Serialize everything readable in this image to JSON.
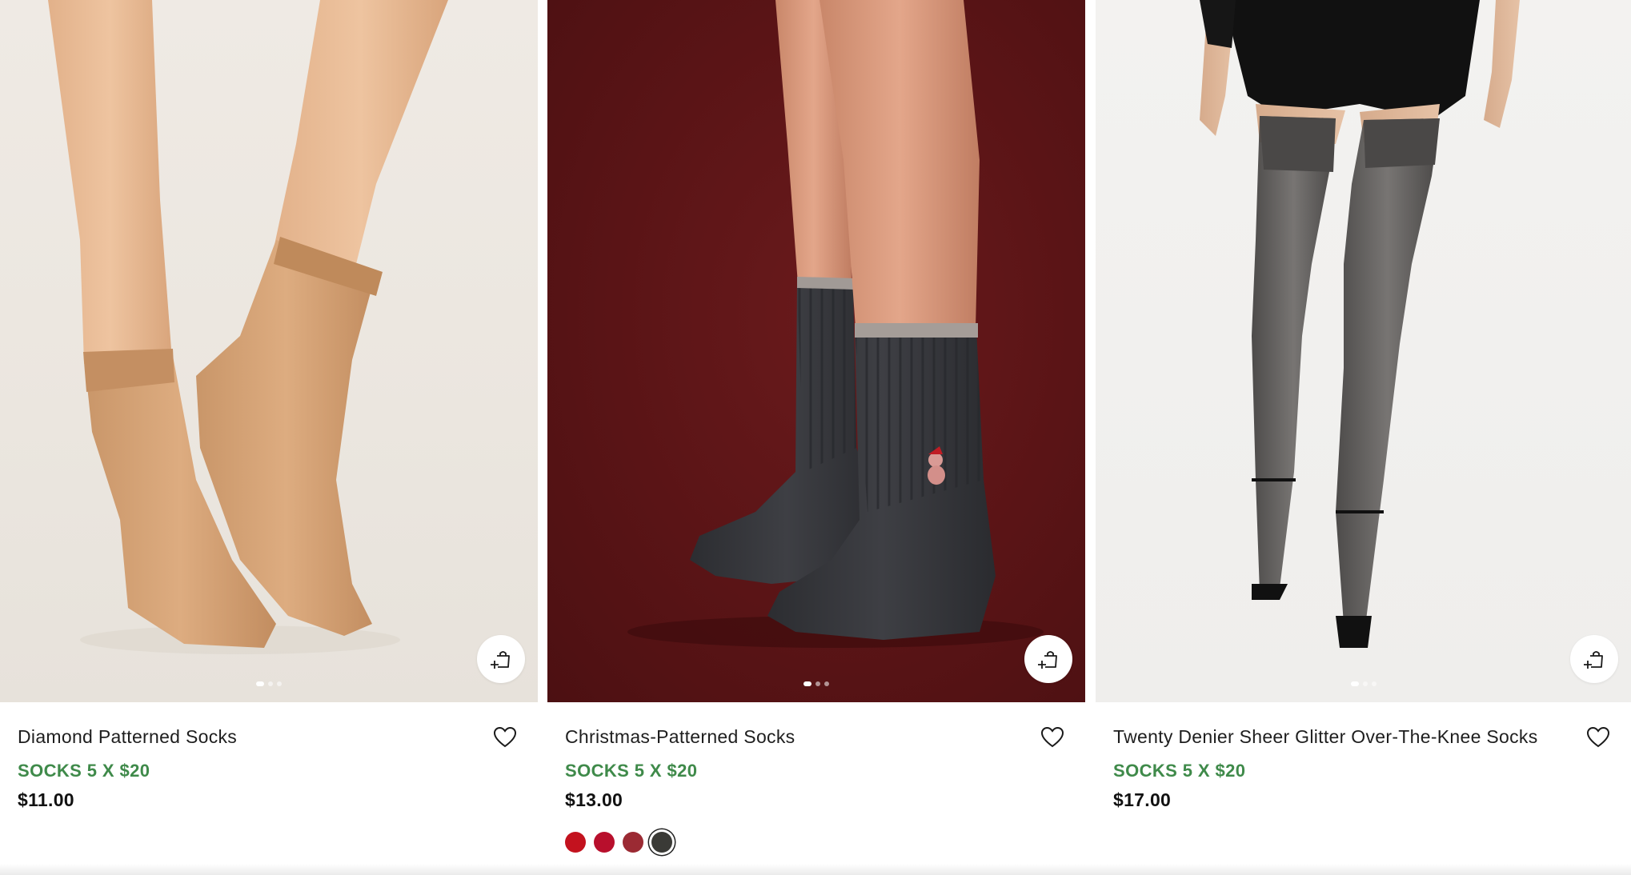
{
  "products": [
    {
      "name": "Diamond Patterned Socks",
      "promo": "SOCKS 5 X $20",
      "price": "$11.00",
      "image_dots": 3,
      "active_dot": 1
    },
    {
      "name": "Christmas-Patterned Socks",
      "promo": "SOCKS 5 X $20",
      "price": "$13.00",
      "image_dots": 3,
      "active_dot": 1,
      "swatches": [
        "#c3121e",
        "#b80f2c",
        "#9b2a33",
        "#3a3a36"
      ],
      "selected_swatch": 4
    },
    {
      "name": "Twenty Denier Sheer Glitter Over-The-Knee Socks",
      "promo": "SOCKS 5 X $20",
      "price": "$17.00",
      "image_dots": 3,
      "active_dot": 1
    }
  ],
  "icons": {
    "quick_add": "bag-plus-icon",
    "wishlist": "heart-icon"
  },
  "colors": {
    "promo_green": "#3f8a4a",
    "text": "#1e1e1e"
  }
}
